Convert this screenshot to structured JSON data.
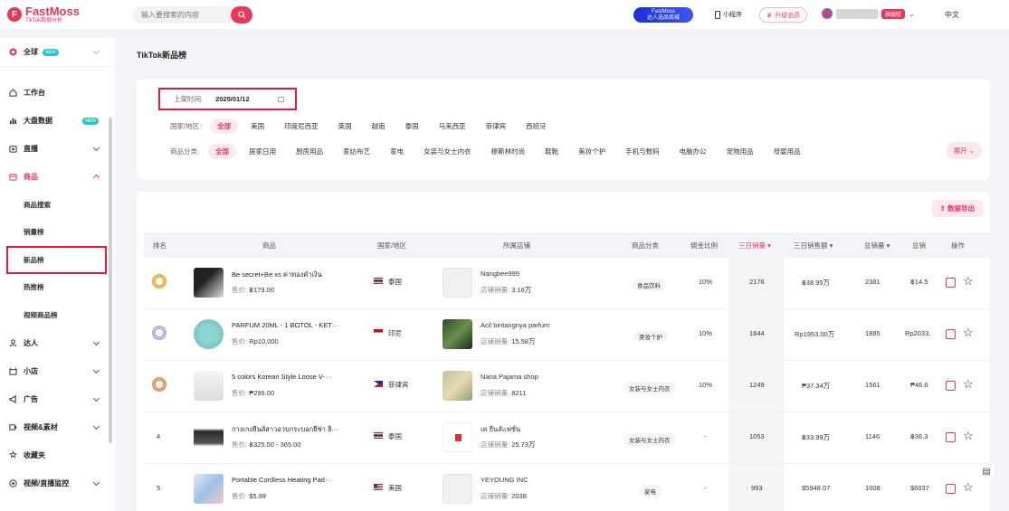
{
  "header": {
    "logo_name": "FastMoss",
    "logo_sub": "TikTok数据分析",
    "search_placeholder": "输入要搜索的内容",
    "promo_line1": "FastMoss",
    "promo_line2": "达人选品商城",
    "mini_program": "小程序",
    "upgrade": "升级会员",
    "plan_badge": "旗舰版",
    "language": "中文"
  },
  "sidebar": {
    "global": "全球",
    "new_tag": "NEW",
    "items": [
      {
        "label": "工作台"
      },
      {
        "label": "大盘数据",
        "tag": "NEW"
      },
      {
        "label": "直播"
      },
      {
        "label": "商品"
      }
    ],
    "sub_items": [
      "商品搜索",
      "销量榜",
      "新品榜",
      "热推榜",
      "视频商品榜"
    ],
    "items_after": [
      "达人",
      "小店",
      "广告",
      "视频&素材",
      "收藏夹",
      "视频/直播监控"
    ]
  },
  "page": {
    "title": "TikTok新品榜"
  },
  "filters": {
    "date_label": "上架时间:",
    "date_value": "2025/01/12",
    "region_label": "国家/地区:",
    "regions": [
      "全部",
      "美国",
      "印度尼西亚",
      "英国",
      "越南",
      "泰国",
      "马来西亚",
      "菲律宾",
      "西班牙"
    ],
    "category_label": "商品分类:",
    "categories": [
      "全部",
      "居家日用",
      "厨房用品",
      "家纺布艺",
      "家电",
      "女装与女士内衣",
      "穆斯林时尚",
      "鞋靴",
      "美妆个护",
      "手机与数码",
      "电脑办公",
      "宠物用品",
      "母婴用品"
    ],
    "expand": "展开"
  },
  "table": {
    "export": "数据导出",
    "columns": [
      "排名",
      "商品",
      "国家/地区",
      "所属店铺",
      "商品分类",
      "佣金比例",
      "三日销量",
      "三日销售额",
      "总销量",
      "总销",
      "操作"
    ],
    "price_label": "售价:",
    "shop_sales_label": "店铺销量:",
    "rows": [
      {
        "rank": "",
        "name": "Be secret+Be xs ค่าทองคำเงิน",
        "price": "฿179.00",
        "country": "泰国",
        "shop": "Nangbee999",
        "shop_sales": "3.16万",
        "category": "食品饮料",
        "commission": "10%",
        "sales3d": "2176",
        "revenue3d": "฿38.95万",
        "total_sales": "2381",
        "total_rev": "฿14.5"
      },
      {
        "rank": "",
        "name": "PARFUM 20ML - 1 BOTOL - KET···",
        "price": "Rp10,000",
        "country": "印尼",
        "shop": "Acil bintangnya parfum",
        "shop_sales": "15.58万",
        "category": "美妆个护",
        "commission": "10%",
        "sales3d": "1844",
        "revenue3d": "Rp1953.00万",
        "total_sales": "1885",
        "total_rev": "Rp2033."
      },
      {
        "rank": "",
        "name": "5 colors Korean Style Loose V-···",
        "price": "₱299.00",
        "country": "菲律宾",
        "shop": "Nana Pajama shop",
        "shop_sales": "8211",
        "category": "女装与女士内衣",
        "commission": "10%",
        "sales3d": "1249",
        "revenue3d": "₱37.34万",
        "total_sales": "1561",
        "total_rev": "₱46.6"
      },
      {
        "rank": "4",
        "name": "กางเกงยีนส์สาวอวบกระบอกยีช่า ฮิ···",
        "price": "฿325.00 - 365.00",
        "country": "泰国",
        "shop": "เค ยีนส์แฟชั่น",
        "shop_sales": "25.73万",
        "category": "女装与女士内衣",
        "commission": "-",
        "sales3d": "1053",
        "revenue3d": "฿33.99万",
        "total_sales": "1146",
        "total_rev": "฿36.3"
      },
      {
        "rank": "5",
        "name": "Portable Cordless Heating Pad···",
        "price": "$5.99",
        "country": "美国",
        "shop": "YEYOUNG INC",
        "shop_sales": "2038",
        "category": "家电",
        "commission": "-",
        "sales3d": "993",
        "revenue3d": "$5948.07",
        "total_sales": "1008",
        "total_rev": "$6037"
      }
    ]
  },
  "colors": {
    "accent": "#e8385a",
    "frame": "#e8173b"
  }
}
